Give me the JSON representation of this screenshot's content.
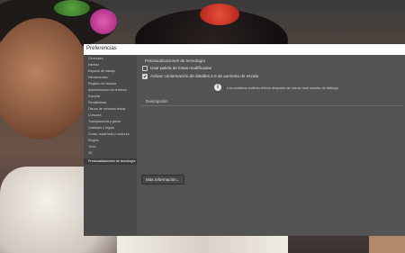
{
  "dialog": {
    "title": "Preferencias",
    "sidebar": {
      "items": [
        {
          "label": "Generales"
        },
        {
          "label": "Interfaz"
        },
        {
          "label": "Espacio de trabajo"
        },
        {
          "label": "Herramientas"
        },
        {
          "label": "Registro de historia"
        },
        {
          "label": "Administración de archivos"
        },
        {
          "label": "Exportar"
        },
        {
          "label": "Rendimiento"
        },
        {
          "label": "Discos de memoria virtual"
        },
        {
          "label": "Cursores"
        },
        {
          "label": "Transparencia y gama"
        },
        {
          "label": "Unidades y reglas"
        },
        {
          "label": "Guías, cuadrícula y sectores"
        },
        {
          "label": "Plugins"
        },
        {
          "label": "Texto"
        },
        {
          "label": "3D"
        },
        {
          "label": "Previsualizaciones de tecnología"
        }
      ],
      "selected_index": 16
    },
    "content": {
      "section_title": "Previsualizaciones de tecnología",
      "options": [
        {
          "label": "Usar paleta de tintas modificadas",
          "checked": false
        },
        {
          "label": "Activar conservación de detalles 2.0 de aumento de escala",
          "checked": true
        }
      ],
      "info_icon": "info-icon",
      "info_message": "Los cambios surtirán efecto después de cerrar este cuadro de diálogo",
      "description_label": "Descripción",
      "more_info_button": "Más información..."
    }
  }
}
